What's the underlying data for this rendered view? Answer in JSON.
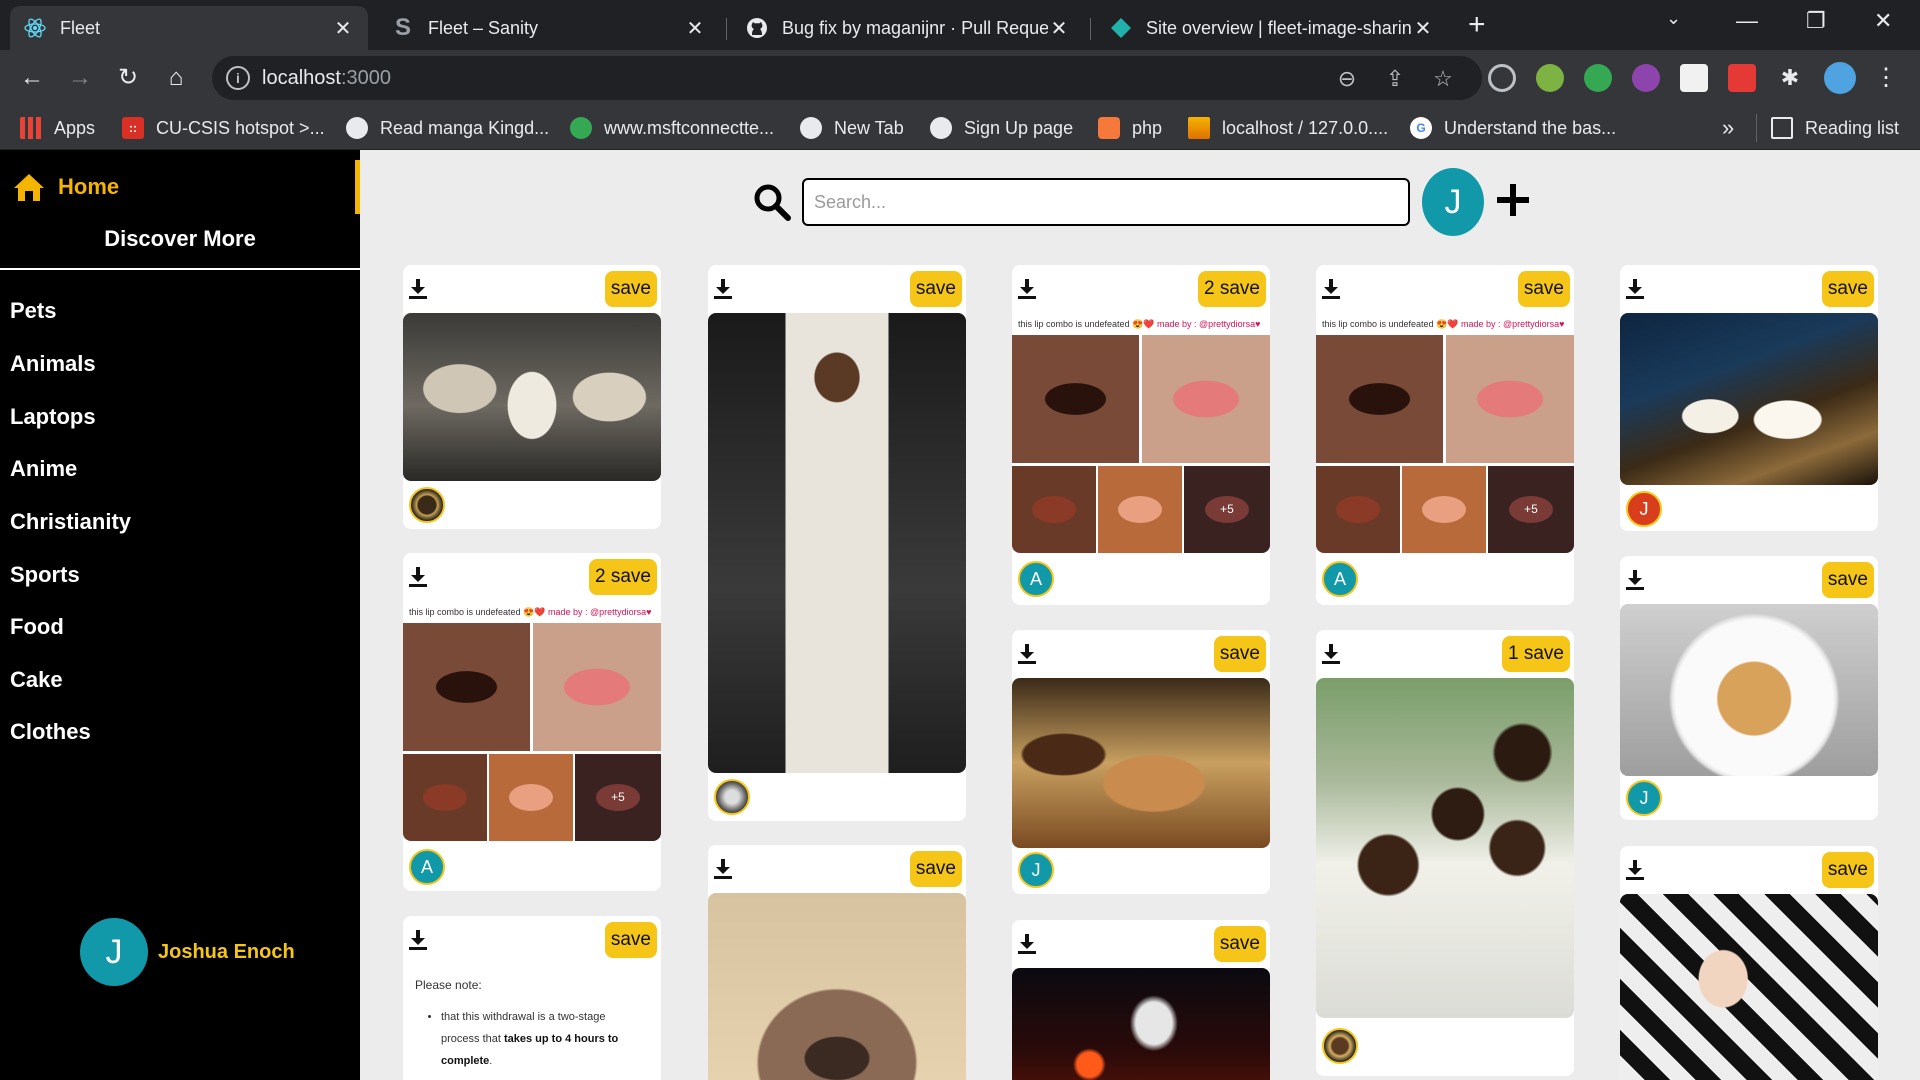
{
  "browser": {
    "tabs": [
      {
        "title": "Fleet",
        "active": true,
        "icon": "react-icon"
      },
      {
        "title": "Fleet – Sanity",
        "active": false,
        "icon": "sanity-icon"
      },
      {
        "title": "Bug fix by maganijnr · Pull Reque",
        "active": false,
        "icon": "github-icon"
      },
      {
        "title": "Site overview | fleet-image-sharin",
        "active": false,
        "icon": "netlify-icon"
      }
    ],
    "close_glyph": "✕",
    "newtab_glyph": "+",
    "window": {
      "minimize": "—",
      "restore": "❐",
      "close": "✕"
    },
    "address": {
      "host": "localhost",
      "port": ":3000"
    },
    "bookmarks": [
      {
        "label": "Apps",
        "icon": "apps-grid-icon",
        "color": "#ea4335"
      },
      {
        "label": "CU-CSIS hotspot >...",
        "icon": "hotspot-icon",
        "color": "#d93025"
      },
      {
        "label": "Read manga Kingd...",
        "icon": "globe-icon",
        "color": "#5f6368"
      },
      {
        "label": "www.msftconnectte...",
        "icon": "msft-icon",
        "color": "#34a853"
      },
      {
        "label": "New Tab",
        "icon": "globe-icon",
        "color": "#5f6368"
      },
      {
        "label": "Sign Up page",
        "icon": "globe-icon",
        "color": "#5f6368"
      },
      {
        "label": "php",
        "icon": "php-icon",
        "color": "#f5793a"
      },
      {
        "label": "localhost / 127.0.0....",
        "icon": "phpmyadmin-icon",
        "color": "#f5b400"
      },
      {
        "label": "Understand the bas...",
        "icon": "google-icon",
        "color": "#4285f4"
      }
    ],
    "bookmarks_more": "»",
    "reading_list": "Reading list"
  },
  "sidebar": {
    "home": "Home",
    "discover": "Discover More",
    "categories": [
      "Pets",
      "Animals",
      "Laptops",
      "Anime",
      "Christianity",
      "Sports",
      "Food",
      "Cake",
      "Clothes"
    ],
    "user": {
      "initial": "J",
      "name": "Joshua Enoch"
    }
  },
  "header": {
    "search_placeholder": "Search...",
    "avatar_initial": "J"
  },
  "pins": [
    {
      "save": "save",
      "user": ""
    },
    {
      "save": "2 save",
      "caption": "this lip combo is undefeated 😍❤️",
      "credit": "made by : @prettydiorsa♥",
      "more": "+5",
      "user": "A"
    },
    {
      "save": "save",
      "note_title": "Please note:",
      "note_body": "that this withdrawal is a two-stage process that",
      "note_bold": "takes up to 4 hours to complete",
      "note_end": "."
    },
    {
      "save": "save",
      "user": ""
    },
    {
      "save": "save"
    },
    {
      "save": "2 save",
      "caption": "this lip combo is undefeated 😍❤️",
      "credit": "made by : @prettydiorsa♥",
      "more": "+5",
      "user": "A"
    },
    {
      "save": "save",
      "user": "J"
    },
    {
      "save": "save"
    },
    {
      "save": "save",
      "caption": "this lip combo is undefeated 😍❤️",
      "credit": "made by : @prettydiorsa♥",
      "more": "+5",
      "user": "A"
    },
    {
      "save": "1 save",
      "user": ""
    },
    {
      "save": "save",
      "user": "J"
    },
    {
      "save": "save",
      "user": "J"
    },
    {
      "save": "save"
    }
  ],
  "colors": {
    "accent": "#f5c518",
    "avatar": "#1199aa",
    "sidebar_bg": "#000000",
    "main_bg": "#ececec"
  }
}
